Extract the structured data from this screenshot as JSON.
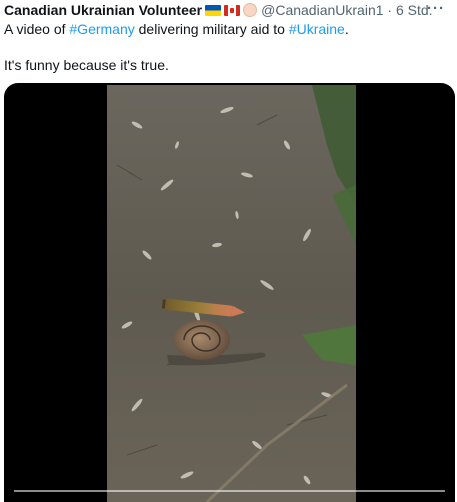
{
  "author": {
    "display_name": "Canadian Ukrainian Volunteer",
    "badges": [
      "ukraine-flag-emoji",
      "canada-flag-emoji",
      "raised-fist-emoji"
    ],
    "handle": "@CanadianUkrain1",
    "separator": "·",
    "time": "6 Std."
  },
  "more_label": "···",
  "tweet": {
    "line1_before": "A video of ",
    "tag1": "#Germany",
    "line1_middle": " delivering military aid to ",
    "tag2": "#Ukraine",
    "line1_after": ".",
    "line2": "It's funny because it's true."
  },
  "video": {
    "content": "snail carrying a rifle cartridge on a dirt path"
  },
  "colors": {
    "link": "#1d9bf0",
    "secondary_text": "#536471",
    "video_background": "#000000"
  }
}
